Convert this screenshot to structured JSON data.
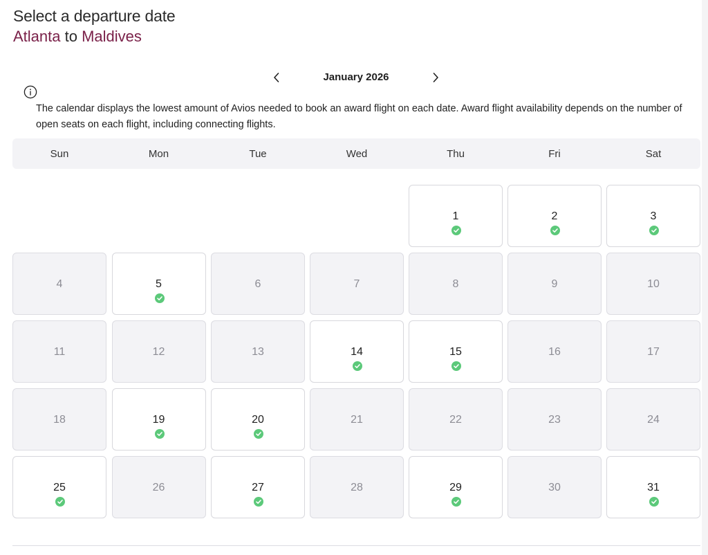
{
  "header": {
    "title": "Select a departure date",
    "origin": "Atlanta",
    "connector": "to",
    "destination": "Maldives"
  },
  "colors": {
    "city_accent": "#7a2149",
    "available_check": "#5cc97a",
    "unavailable_bg": "#f3f3f6"
  },
  "calendar": {
    "month_label": "January 2026",
    "prev_icon": "chevron-left-icon",
    "next_icon": "chevron-right-icon",
    "info_icon": "info-icon",
    "info_text": "The calendar displays the lowest amount of Avios needed to book an award flight on each date. Award flight availability depends on the number of open seats on each flight, including connecting flights.",
    "weekdays": [
      "Sun",
      "Mon",
      "Tue",
      "Wed",
      "Thu",
      "Fri",
      "Sat"
    ],
    "first_weekday_index": 4,
    "days": [
      {
        "day": "1",
        "available": true
      },
      {
        "day": "2",
        "available": true
      },
      {
        "day": "3",
        "available": true
      },
      {
        "day": "4",
        "available": false
      },
      {
        "day": "5",
        "available": true
      },
      {
        "day": "6",
        "available": false
      },
      {
        "day": "7",
        "available": false
      },
      {
        "day": "8",
        "available": false
      },
      {
        "day": "9",
        "available": false
      },
      {
        "day": "10",
        "available": false
      },
      {
        "day": "11",
        "available": false
      },
      {
        "day": "12",
        "available": false
      },
      {
        "day": "13",
        "available": false
      },
      {
        "day": "14",
        "available": true
      },
      {
        "day": "15",
        "available": true
      },
      {
        "day": "16",
        "available": false
      },
      {
        "day": "17",
        "available": false
      },
      {
        "day": "18",
        "available": false
      },
      {
        "day": "19",
        "available": true
      },
      {
        "day": "20",
        "available": true
      },
      {
        "day": "21",
        "available": false
      },
      {
        "day": "22",
        "available": false
      },
      {
        "day": "23",
        "available": false
      },
      {
        "day": "24",
        "available": false
      },
      {
        "day": "25",
        "available": true
      },
      {
        "day": "26",
        "available": false
      },
      {
        "day": "27",
        "available": true
      },
      {
        "day": "28",
        "available": false
      },
      {
        "day": "29",
        "available": true
      },
      {
        "day": "30",
        "available": false
      },
      {
        "day": "31",
        "available": true
      }
    ]
  }
}
